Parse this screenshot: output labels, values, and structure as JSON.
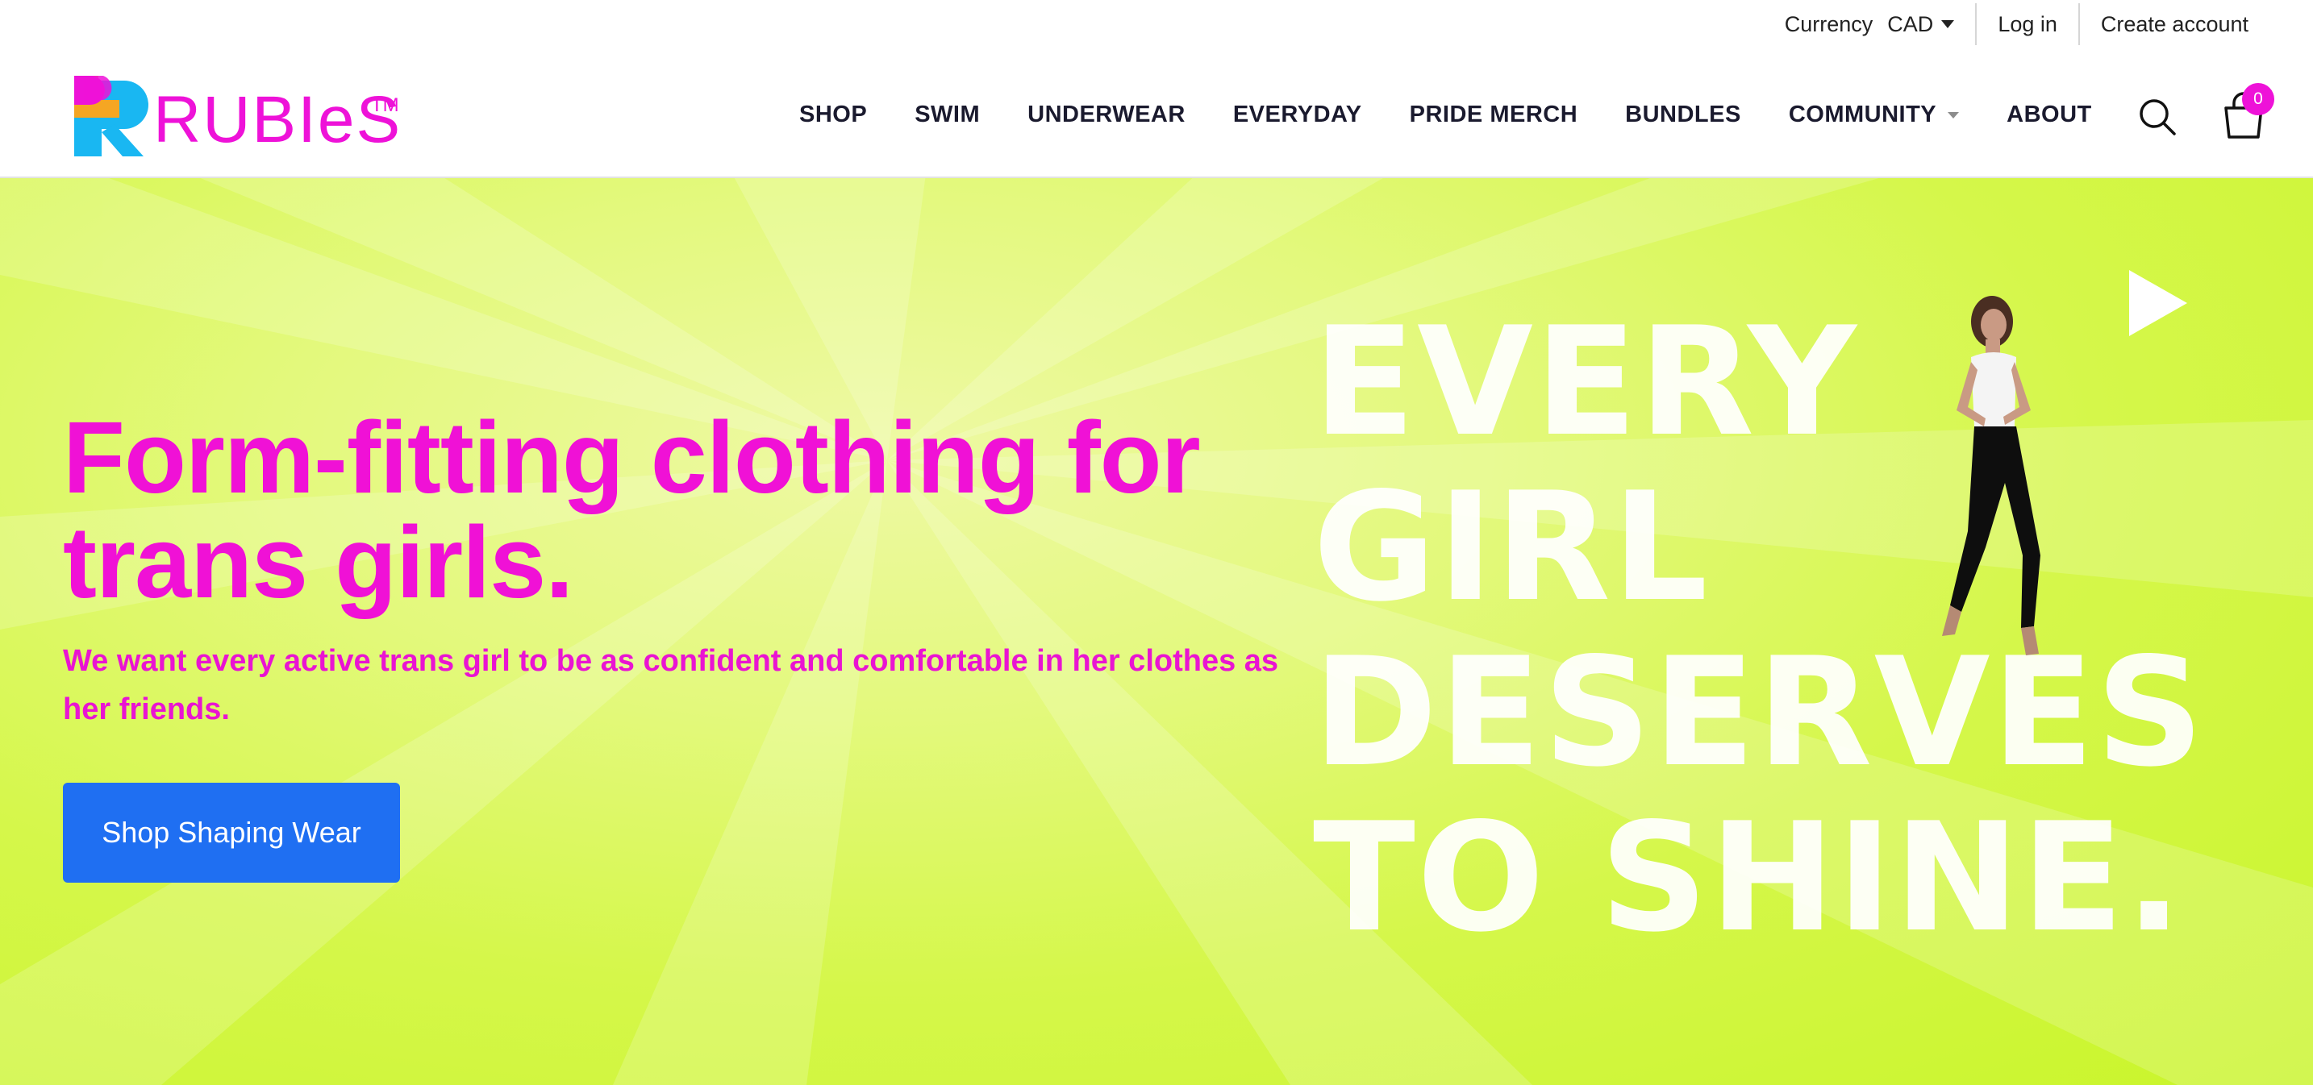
{
  "utility": {
    "currency_label": "Currency",
    "currency_value": "CAD",
    "login": "Log in",
    "create_account": "Create account"
  },
  "header": {
    "logo_text": "RUBIeS™",
    "nav": [
      {
        "label": "SHOP"
      },
      {
        "label": "SWIM"
      },
      {
        "label": "UNDERWEAR"
      },
      {
        "label": "EVERYDAY"
      },
      {
        "label": "PRIDE MERCH"
      },
      {
        "label": "BUNDLES"
      },
      {
        "label": "COMMUNITY",
        "has_dropdown": true
      },
      {
        "label": "ABOUT"
      }
    ],
    "cart_count": "0",
    "icons": [
      "search-icon",
      "cart-icon"
    ]
  },
  "hero": {
    "heading": "Form-fitting clothing for trans girls.",
    "subheading": "We want every active trans girl to be as confident and comfortable in her clothes as her friends.",
    "cta": "Shop Shaping Wear",
    "video_text": [
      "EVERY",
      "GIRL",
      "DESERVES",
      "TO SHINE."
    ],
    "icons": [
      "play-icon"
    ]
  },
  "colors": {
    "brand_pink": "#f011d6",
    "hero_bg": "#d5f74a",
    "cta_blue": "#1f6ff2",
    "logo_orange": "#f5a623",
    "logo_blue": "#19b7f2"
  }
}
